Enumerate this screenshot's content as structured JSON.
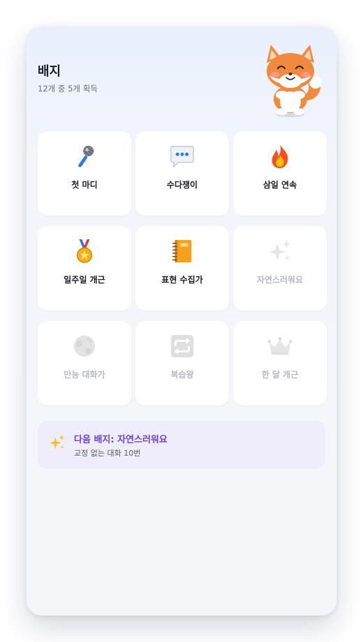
{
  "header": {
    "title": "배지",
    "progress_text": "12개 중 5개 획득"
  },
  "badges": [
    {
      "label": "첫 마디",
      "icon": "microphone-icon",
      "earned": true
    },
    {
      "label": "수다쟁이",
      "icon": "speech-bubble-icon",
      "earned": true
    },
    {
      "label": "삼일 연속",
      "icon": "fire-icon",
      "earned": true
    },
    {
      "label": "일주일 개근",
      "icon": "medal-icon",
      "earned": true
    },
    {
      "label": "표현 수집가",
      "icon": "notebook-icon",
      "earned": true
    },
    {
      "label": "자연스러워요",
      "icon": "sparkles-icon",
      "earned": false
    },
    {
      "label": "만능 대화가",
      "icon": "globe-icon",
      "earned": false
    },
    {
      "label": "복습왕",
      "icon": "repeat-icon",
      "earned": false
    },
    {
      "label": "한 달 개근",
      "icon": "crown-icon",
      "earned": false
    }
  ],
  "next_badge": {
    "title": "다음 배지: 자연스러워요",
    "description": "교정 없는 대화 10번",
    "icon": "sparkles-icon"
  },
  "colors": {
    "accent": "#6a3fe0",
    "next_box_bg": "#efecfb",
    "card_bg": "#ffffff",
    "locked_text": "#b5b8c0"
  }
}
